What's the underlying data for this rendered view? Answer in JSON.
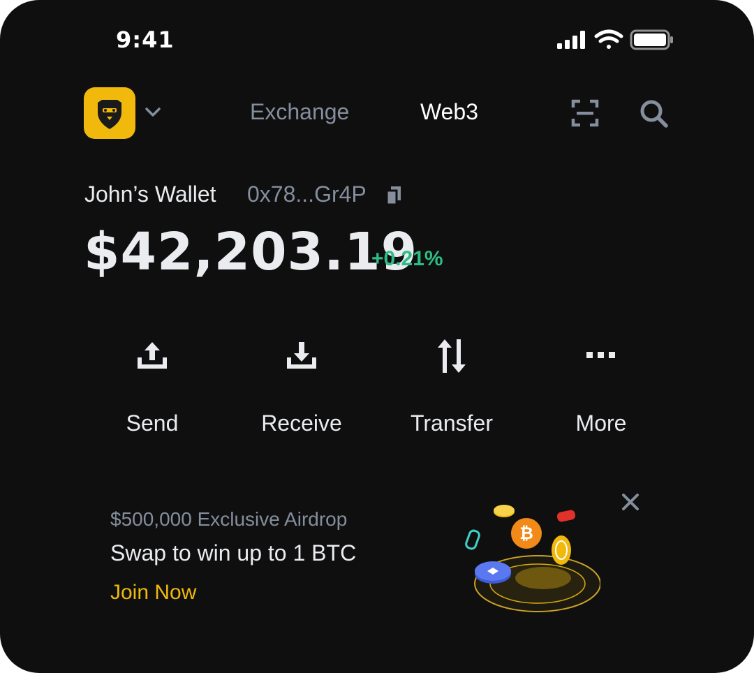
{
  "status_bar": {
    "time": "9:41"
  },
  "header": {
    "tabs": [
      {
        "label": "Exchange",
        "active": false
      },
      {
        "label": "Web3",
        "active": true
      }
    ]
  },
  "wallet": {
    "name": "John’s Wallet",
    "address": "0x78...Gr4P",
    "balance": "$42,203.19",
    "change": "+0.21%"
  },
  "actions": [
    {
      "label": "Send",
      "icon": "upload-icon"
    },
    {
      "label": "Receive",
      "icon": "download-icon"
    },
    {
      "label": "Transfer",
      "icon": "swap-arrows-icon"
    },
    {
      "label": "More",
      "icon": "more-dots-icon"
    }
  ],
  "banner": {
    "subtitle": "$500,000 Exclusive Airdrop",
    "title": "Swap to win up to 1 BTC",
    "cta": "Join Now"
  },
  "colors": {
    "background": "#0f0f10",
    "brand": "#f0b90b",
    "positive": "#2ebd85",
    "muted": "#848e9c",
    "text": "#eaecef"
  }
}
